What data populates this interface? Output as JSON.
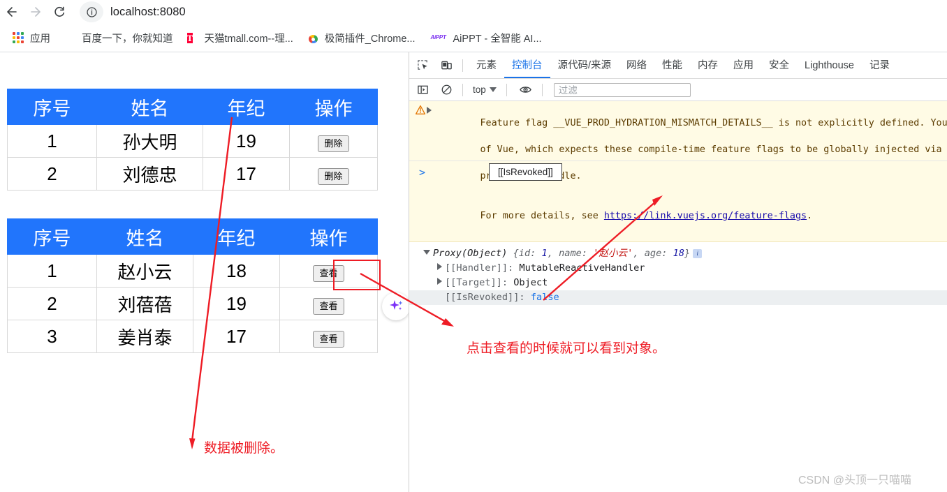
{
  "browser": {
    "back_label": "Back",
    "forward_label": "Forward",
    "reload_label": "Reload",
    "site_info_label": "View site information",
    "url": "localhost:8080",
    "bookmarks": [
      {
        "label": "应用",
        "icon": "apps-grid-icon"
      },
      {
        "label": "百度一下，你就知道",
        "icon": "baidu-icon"
      },
      {
        "label": "天猫tmall.com--理...",
        "icon": "tmall-icon"
      },
      {
        "label": "极简插件_Chrome...",
        "icon": "chrome-store-icon"
      },
      {
        "label": "AiPPT - 全智能 AI...",
        "icon": "aippt-icon"
      }
    ]
  },
  "page": {
    "table1": {
      "headers": [
        "序号",
        "姓名",
        "年纪",
        "操作"
      ],
      "rows": [
        {
          "index": "1",
          "name": "孙大明",
          "age": "19",
          "action": "删除"
        },
        {
          "index": "2",
          "name": "刘德忠",
          "age": "17",
          "action": "删除"
        }
      ]
    },
    "table2": {
      "headers": [
        "序号",
        "姓名",
        "年纪",
        "操作"
      ],
      "rows": [
        {
          "index": "1",
          "name": "赵小云",
          "age": "18",
          "action": "查看"
        },
        {
          "index": "2",
          "name": "刘蓓蓓",
          "age": "19",
          "action": "查看"
        },
        {
          "index": "3",
          "name": "姜肖泰",
          "age": "17",
          "action": "查看"
        }
      ]
    },
    "header_bg_color": "#2175fc",
    "sparkle_icon": "ai-sparkle-icon"
  },
  "devtools": {
    "toolbar_icons": [
      "inspect-element-icon",
      "device-toolbar-icon"
    ],
    "tabs": [
      {
        "label": "元素",
        "active": false
      },
      {
        "label": "控制台",
        "active": true
      },
      {
        "label": "源代码/来源",
        "active": false
      },
      {
        "label": "网络",
        "active": false
      },
      {
        "label": "性能",
        "active": false
      },
      {
        "label": "内存",
        "active": false
      },
      {
        "label": "应用",
        "active": false
      },
      {
        "label": "安全",
        "active": false
      },
      {
        "label": "Lighthouse",
        "active": false
      },
      {
        "label": "记录",
        "active": false
      }
    ],
    "console_toolbar": {
      "sidebar_icon": "console-sidebar-icon",
      "clear_icon": "clear-console-icon",
      "context": "top",
      "eye_icon": "live-expression-eye-icon",
      "filter_placeholder": "过滤",
      "filter_value": ""
    },
    "warning": {
      "icon": "warning-triangle-icon",
      "line1": "Feature flag __VUE_PROD_HYDRATION_MISMATCH_DETAILS__ is not explicitly defined. You are",
      "line2": "of Vue, which expects these compile-time feature flags to be globally injected via the bu",
      "line3": "production bundle.",
      "line4_prefix": "For more details, see ",
      "link": "https://link.vuejs.org/feature-flags",
      "line4_suffix": "."
    },
    "object_output": {
      "summary_prefix": "Proxy(Object) ",
      "brace_open": "{",
      "prop_id_key": "id: ",
      "prop_id_value": "1",
      "prop_id_sep": ", ",
      "prop_name_key": "name: ",
      "prop_name_value": "'赵小云'",
      "prop_name_sep": ", ",
      "prop_age_key": "age: ",
      "prop_age_value": "18",
      "brace_close": "}",
      "info_badge": "i",
      "rows": [
        {
          "key": "[[Handler]]:",
          "value": "MutableReactiveHandler",
          "expandable": true
        },
        {
          "key": "[[Target]]:",
          "value": "Object",
          "expandable": true
        },
        {
          "key": "[[IsRevoked]]:",
          "value": "false",
          "expandable": false
        }
      ]
    },
    "tooltip": "[[IsRevoked]]",
    "prompt": ">"
  },
  "annotations": {
    "delete_note": "数据被删除。",
    "view_note": "点击查看的时候就可以看到对象。",
    "arrow_color": "#ee1c25",
    "highlight_color": "#ee1c25"
  },
  "watermark": "CSDN @头顶一只喵喵"
}
